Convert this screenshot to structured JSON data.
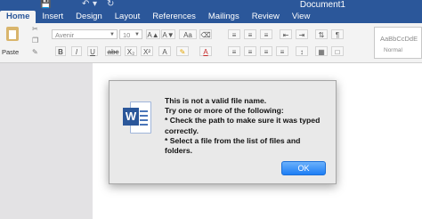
{
  "window": {
    "title": "Document1",
    "qat": {
      "save_icon": "save-icon",
      "undo_icon": "undo-icon",
      "redo_icon": "redo-icon"
    }
  },
  "tabs": [
    {
      "label": "Home",
      "active": true
    },
    {
      "label": "Insert"
    },
    {
      "label": "Design"
    },
    {
      "label": "Layout"
    },
    {
      "label": "References"
    },
    {
      "label": "Mailings"
    },
    {
      "label": "Review"
    },
    {
      "label": "View"
    }
  ],
  "ribbon": {
    "paste_label": "Paste",
    "font_name": "Avenir",
    "font_size": "10",
    "grow_font": "A▲",
    "shrink_font": "A▼",
    "change_case": "Aa",
    "bold": "B",
    "italic": "I",
    "underline": "U",
    "strikethrough": "abc",
    "subscript": "X₂",
    "superscript": "X²",
    "font_color": "A",
    "styles_sample": "AaBbCcDdE",
    "styles_name": "Normal"
  },
  "dialog": {
    "app_icon": "word-icon",
    "app_letter": "W",
    "lines": [
      "This is not a valid file name.",
      "Try one or more of the following:",
      "* Check the path to make sure it was typed",
      "correctly.",
      "* Select a file from the list of files and",
      "folders."
    ],
    "ok_label": "OK"
  }
}
